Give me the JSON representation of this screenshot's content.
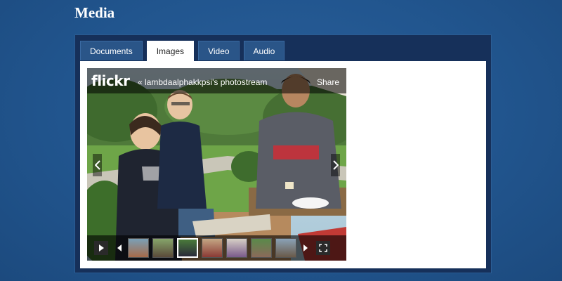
{
  "page": {
    "title": "Media"
  },
  "tabs": [
    {
      "label": "Documents",
      "active": false
    },
    {
      "label": "Images",
      "active": true
    },
    {
      "label": "Video",
      "active": false
    },
    {
      "label": "Audio",
      "active": false
    }
  ],
  "slideshow": {
    "logo": "flickr",
    "stream_link": "« lambdaalphakkpsi's photostream",
    "share_label": "Share",
    "prev_icon": "chevron-left-icon",
    "next_icon": "chevron-right-icon",
    "play_icon": "play-icon",
    "fullscreen_icon": "fullscreen-icon",
    "thumbnail_count": 7,
    "selected_thumbnail": 3
  },
  "colors": {
    "background": "#21558e",
    "panel": "#16305a",
    "tab": "#2a5588",
    "tab_active": "#ffffff"
  }
}
